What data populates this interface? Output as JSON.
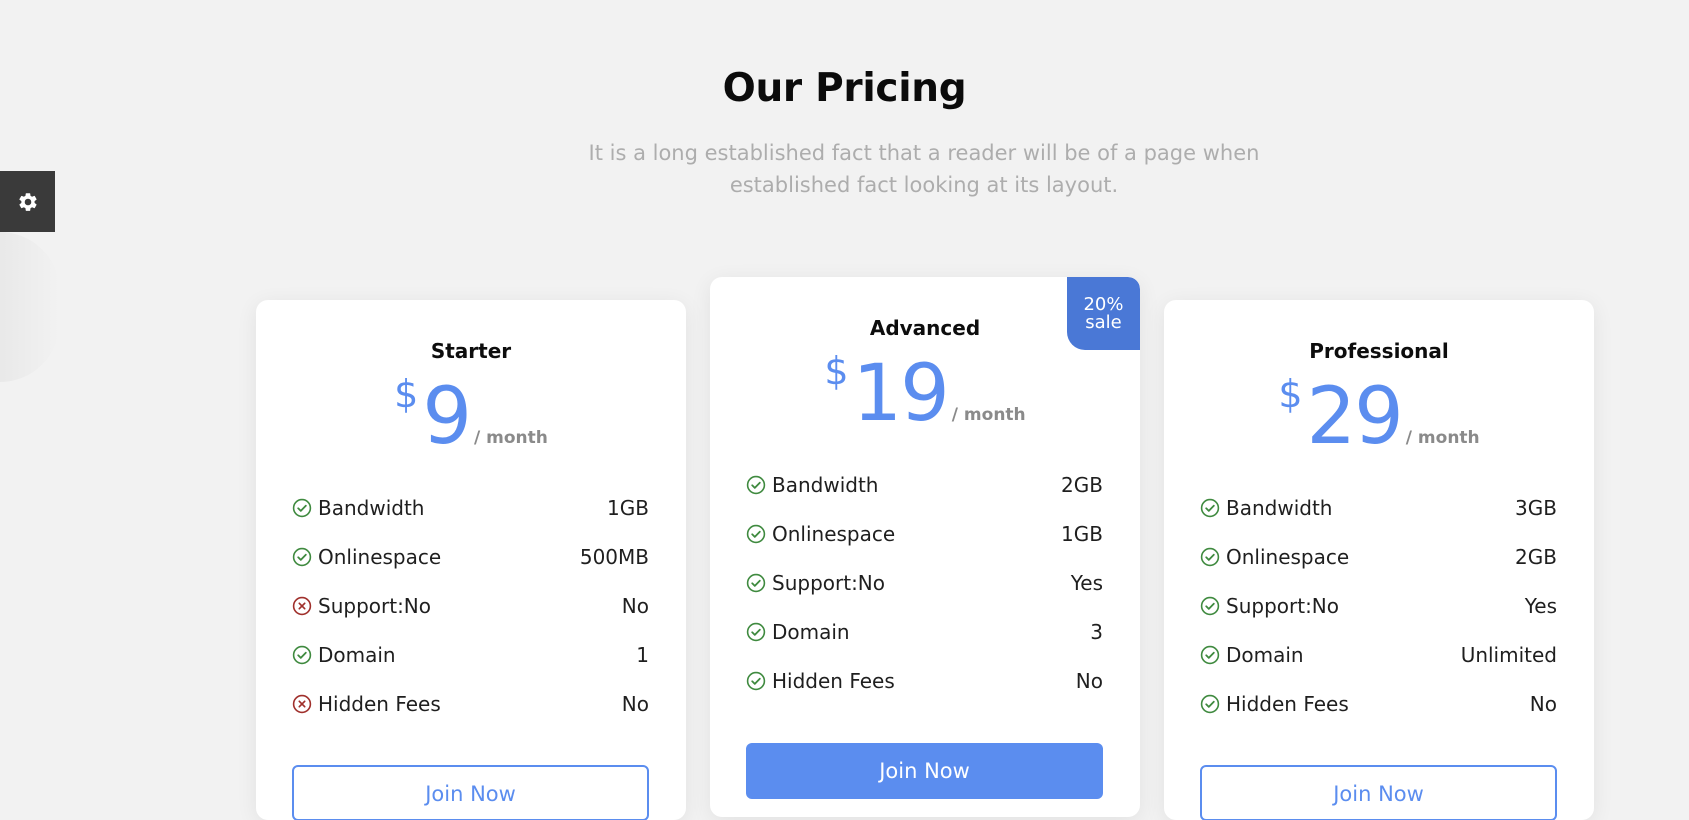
{
  "settings": {
    "icon": "gear-icon"
  },
  "section": {
    "title": "Our Pricing",
    "subtitle": "It is a long established fact that a reader will be of a page when established fact looking at its layout."
  },
  "plans": [
    {
      "name": "Starter",
      "currency": "$",
      "price": "9",
      "period": "/ month",
      "features": [
        {
          "label": "Bandwidth",
          "value": "1GB",
          "included": true
        },
        {
          "label": "Onlinespace",
          "value": "500MB",
          "included": true
        },
        {
          "label": "Support:No",
          "value": "No",
          "included": false
        },
        {
          "label": "Domain",
          "value": "1",
          "included": true
        },
        {
          "label": "Hidden Fees",
          "value": "No",
          "included": false
        }
      ],
      "button": "Join Now"
    },
    {
      "name": "Advanced",
      "currency": "$",
      "price": "19",
      "period": "/ month",
      "badge": {
        "line1": "20%",
        "line2": "sale"
      },
      "features": [
        {
          "label": "Bandwidth",
          "value": "2GB",
          "included": true
        },
        {
          "label": "Onlinespace",
          "value": "1GB",
          "included": true
        },
        {
          "label": "Support:No",
          "value": "Yes",
          "included": true
        },
        {
          "label": "Domain",
          "value": "3",
          "included": true
        },
        {
          "label": "Hidden Fees",
          "value": "No",
          "included": true
        }
      ],
      "button": "Join Now"
    },
    {
      "name": "Professional",
      "currency": "$",
      "price": "29",
      "period": "/ month",
      "features": [
        {
          "label": "Bandwidth",
          "value": "3GB",
          "included": true
        },
        {
          "label": "Onlinespace",
          "value": "2GB",
          "included": true
        },
        {
          "label": "Support:No",
          "value": "Yes",
          "included": true
        },
        {
          "label": "Domain",
          "value": "Unlimited",
          "included": true
        },
        {
          "label": "Hidden Fees",
          "value": "No",
          "included": true
        }
      ],
      "button": "Join Now"
    }
  ],
  "colors": {
    "accent": "#5b8def",
    "badge": "#4a78d6",
    "check": "#3f8a3f",
    "cross": "#a0302c"
  }
}
